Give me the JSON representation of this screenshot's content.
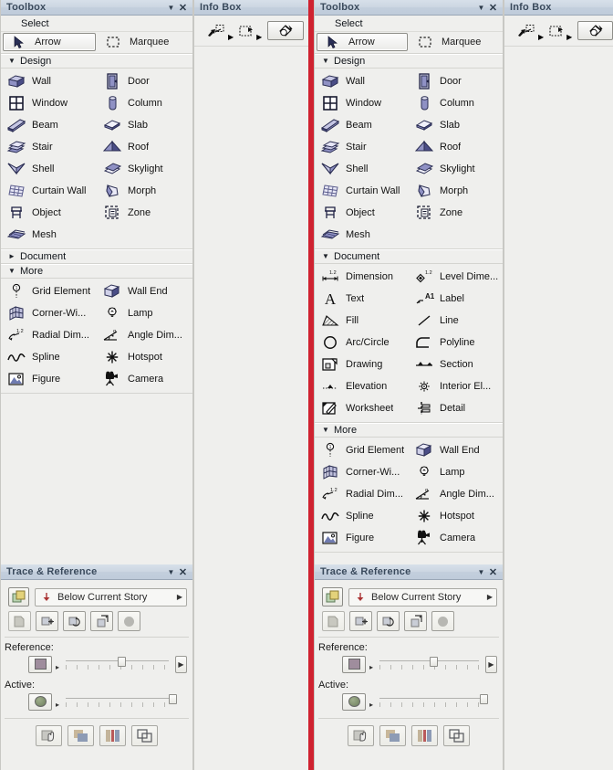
{
  "app": {
    "accent_red": "#cf2230",
    "panel_bg": "#efefed",
    "titlebar_bg": "#c9d4e0"
  },
  "panels": {
    "toolbox_title": "Toolbox",
    "infobox_title": "Info Box",
    "trace_title": "Trace & Reference",
    "caret_glyph": "▼",
    "close_glyph": "✕"
  },
  "toolbox": {
    "select_group": {
      "label": "Select",
      "items": [
        {
          "label": "Arrow",
          "icon": "arrow-cursor-icon",
          "active": true
        },
        {
          "label": "Marquee",
          "icon": "marquee-icon",
          "active": false
        }
      ]
    },
    "design_group": {
      "label": "Design",
      "arrow": "▼",
      "expanded": true,
      "items": [
        {
          "label": "Wall",
          "icon": "wall-icon"
        },
        {
          "label": "Door",
          "icon": "door-icon"
        },
        {
          "label": "Window",
          "icon": "window-icon"
        },
        {
          "label": "Column",
          "icon": "column-icon"
        },
        {
          "label": "Beam",
          "icon": "beam-icon"
        },
        {
          "label": "Slab",
          "icon": "slab-icon"
        },
        {
          "label": "Stair",
          "icon": "stair-icon"
        },
        {
          "label": "Roof",
          "icon": "roof-icon"
        },
        {
          "label": "Shell",
          "icon": "shell-icon"
        },
        {
          "label": "Skylight",
          "icon": "skylight-icon"
        },
        {
          "label": "Curtain Wall",
          "icon": "curtain-wall-icon"
        },
        {
          "label": "Morph",
          "icon": "morph-icon"
        },
        {
          "label": "Object",
          "icon": "object-icon"
        },
        {
          "label": "Zone",
          "icon": "zone-icon"
        },
        {
          "label": "Mesh",
          "icon": "mesh-icon"
        }
      ]
    },
    "document_group": {
      "label": "Document",
      "arrow_collapsed": "►",
      "arrow_expanded": "▼",
      "items": [
        {
          "label": "Dimension",
          "icon": "dimension-icon"
        },
        {
          "label": "Level Dime...",
          "icon": "level-dimension-icon"
        },
        {
          "label": "Text",
          "icon": "text-icon"
        },
        {
          "label": "Label",
          "icon": "label-icon"
        },
        {
          "label": "Fill",
          "icon": "fill-icon"
        },
        {
          "label": "Line",
          "icon": "line-icon"
        },
        {
          "label": "Arc/Circle",
          "icon": "arc-circle-icon"
        },
        {
          "label": "Polyline",
          "icon": "polyline-icon"
        },
        {
          "label": "Drawing",
          "icon": "drawing-icon"
        },
        {
          "label": "Section",
          "icon": "section-icon"
        },
        {
          "label": "Elevation",
          "icon": "elevation-icon"
        },
        {
          "label": "Interior El...",
          "icon": "interior-elevation-icon"
        },
        {
          "label": "Worksheet",
          "icon": "worksheet-icon"
        },
        {
          "label": "Detail",
          "icon": "detail-icon"
        }
      ]
    },
    "more_group": {
      "label": "More",
      "arrow": "▼",
      "expanded": true,
      "items": [
        {
          "label": "Grid Element",
          "icon": "grid-element-icon"
        },
        {
          "label": "Wall End",
          "icon": "wall-end-icon"
        },
        {
          "label": "Corner-Wi...",
          "icon": "corner-window-icon"
        },
        {
          "label": "Lamp",
          "icon": "lamp-icon"
        },
        {
          "label": "Radial Dim...",
          "icon": "radial-dimension-icon"
        },
        {
          "label": "Angle Dim...",
          "icon": "angle-dimension-icon"
        },
        {
          "label": "Spline",
          "icon": "spline-icon"
        },
        {
          "label": "Hotspot",
          "icon": "hotspot-icon"
        },
        {
          "label": "Figure",
          "icon": "figure-icon"
        },
        {
          "label": "Camera",
          "icon": "camera-icon"
        }
      ]
    }
  },
  "infobox": {
    "tools": [
      {
        "icon": "select-arrow-tool-icon",
        "has_dropdown": true,
        "active": false
      },
      {
        "icon": "marquee-tool-icon",
        "has_dropdown": true,
        "active": false
      },
      {
        "icon": "paint-bucket-tool-icon",
        "has_dropdown": false,
        "active": true
      }
    ],
    "dropdown_glyph": "▶"
  },
  "trace": {
    "story_selector": {
      "value": "Below Current Story",
      "icon": "down-arrow-story-icon",
      "caret": "▶"
    },
    "toggle_icon": "trace-toggle-icon",
    "action_buttons": [
      {
        "icon": "trace-page-icon",
        "enabled": false
      },
      {
        "icon": "move-trace-icon",
        "enabled": true
      },
      {
        "icon": "rotate-trace-icon",
        "enabled": true
      },
      {
        "icon": "align-trace-icon",
        "enabled": true
      },
      {
        "icon": "grey-fill-icon",
        "enabled": true
      }
    ],
    "reference": {
      "label": "Reference:",
      "color": "#9f8d9d",
      "slider_percent": 50,
      "end_caret": "▶"
    },
    "active": {
      "label": "Active:",
      "color": "#7f8f6e",
      "slider_percent": 97
    },
    "bottom_buttons": [
      {
        "icon": "hand-drag-icon"
      },
      {
        "icon": "swap-colors-icon"
      },
      {
        "icon": "split-view-icon"
      },
      {
        "icon": "overlay-icon"
      }
    ]
  }
}
